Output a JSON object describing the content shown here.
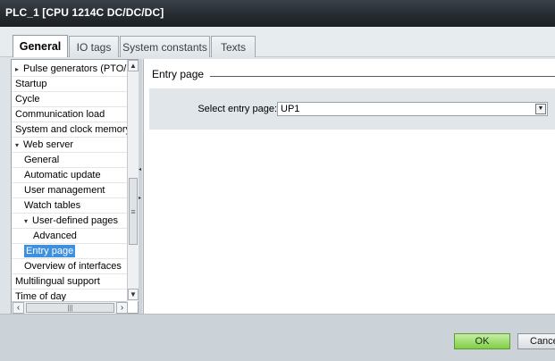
{
  "window": {
    "title": "PLC_1 [CPU 1214C DC/DC/DC]"
  },
  "tabs": [
    {
      "label": "General",
      "active": true
    },
    {
      "label": "IO tags",
      "active": false
    },
    {
      "label": "System constants",
      "active": false
    },
    {
      "label": "Texts",
      "active": false
    }
  ],
  "nav": {
    "items": [
      {
        "label": "Pulse generators (PTO/PWM)",
        "indent": 0,
        "arrow": "▸",
        "selected": false
      },
      {
        "label": "Startup",
        "indent": 0,
        "arrow": "",
        "selected": false
      },
      {
        "label": "Cycle",
        "indent": 0,
        "arrow": "",
        "selected": false
      },
      {
        "label": "Communication load",
        "indent": 0,
        "arrow": "",
        "selected": false
      },
      {
        "label": "System and clock memory",
        "indent": 0,
        "arrow": "",
        "selected": false
      },
      {
        "label": "Web server",
        "indent": 0,
        "arrow": "▾",
        "selected": false
      },
      {
        "label": "General",
        "indent": 1,
        "arrow": "",
        "selected": false
      },
      {
        "label": "Automatic update",
        "indent": 1,
        "arrow": "",
        "selected": false
      },
      {
        "label": "User management",
        "indent": 1,
        "arrow": "",
        "selected": false
      },
      {
        "label": "Watch tables",
        "indent": 1,
        "arrow": "",
        "selected": false
      },
      {
        "label": "User-defined pages",
        "indent": 1,
        "arrow": "▾",
        "selected": false
      },
      {
        "label": "Advanced",
        "indent": 2,
        "arrow": "",
        "selected": false
      },
      {
        "label": "Entry page",
        "indent": 1,
        "arrow": "",
        "selected": true
      },
      {
        "label": "Overview of interfaces",
        "indent": 1,
        "arrow": "",
        "selected": false
      },
      {
        "label": "Multilingual support",
        "indent": 0,
        "arrow": "",
        "selected": false
      },
      {
        "label": "Time of day",
        "indent": 0,
        "arrow": "",
        "selected": false
      }
    ]
  },
  "main": {
    "section_title": "Entry page",
    "entry_page": {
      "label": "Select entry page:",
      "value": "UP1"
    }
  },
  "footer": {
    "ok_label": "OK",
    "cancel_label": "Cancel"
  },
  "colors": {
    "accent_selected": "#3d8fe0",
    "ok_green": "#7fce45",
    "title_bar": "#262b31"
  }
}
